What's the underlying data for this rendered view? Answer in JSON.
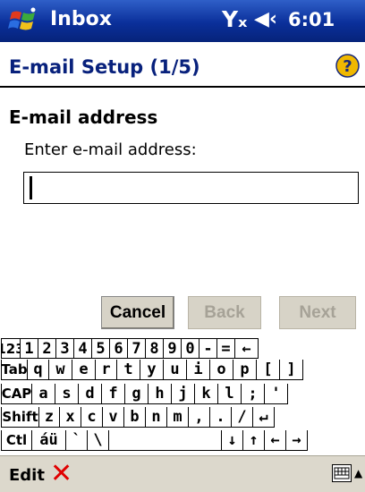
{
  "titlebar": {
    "app_title": "Inbox",
    "signal_glyph": "Yₓ",
    "volume_glyph": "◀‹",
    "clock": "6:01"
  },
  "header": {
    "page_title": "E-mail Setup (1/5)",
    "help_glyph": "?"
  },
  "form": {
    "section_heading": "E-mail address",
    "field_label": "Enter e-mail address:",
    "email_value": "",
    "email_placeholder": ""
  },
  "buttons": {
    "cancel": "Cancel",
    "back": "Back",
    "next": "Next"
  },
  "keyboard": {
    "rows": [
      [
        "123",
        "1",
        "2",
        "3",
        "4",
        "5",
        "6",
        "7",
        "8",
        "9",
        "0",
        "-",
        "=",
        "←"
      ],
      [
        "Tab",
        "q",
        "w",
        "e",
        "r",
        "t",
        "y",
        "u",
        "i",
        "o",
        "p",
        "[",
        "]"
      ],
      [
        "CAP",
        "a",
        "s",
        "d",
        "f",
        "g",
        "h",
        "j",
        "k",
        "l",
        ";",
        "'"
      ],
      [
        "Shift",
        "z",
        "x",
        "c",
        "v",
        "b",
        "n",
        "m",
        ",",
        ".",
        "/",
        "↵"
      ],
      [
        "Ctl",
        "áü",
        "`",
        "\\",
        "",
        "↓",
        "↑",
        "←",
        "→"
      ]
    ]
  },
  "menubar": {
    "edit": "Edit",
    "delete_glyph": "✕",
    "sip_arrow": "▲"
  },
  "colors": {
    "titlebar": "#0a2f9a",
    "page_title": "#08217c",
    "button_face": "#d7d3c7",
    "disabled_text": "#a6a297",
    "delete_red": "#e00000"
  }
}
